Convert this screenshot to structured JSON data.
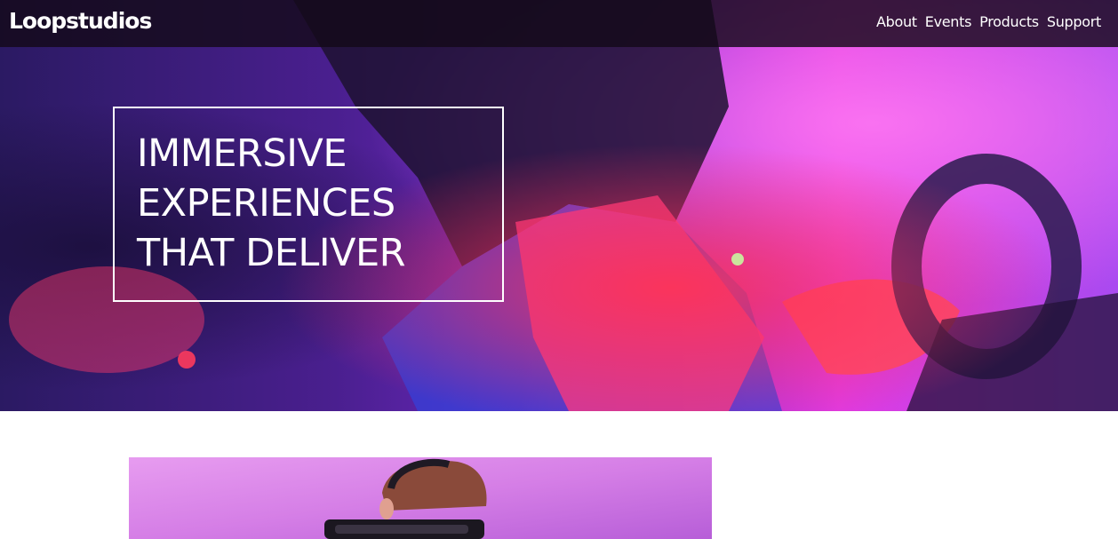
{
  "header": {
    "logo": "Loopstudios",
    "nav": [
      {
        "label": "About"
      },
      {
        "label": "Events"
      },
      {
        "label": "Products"
      },
      {
        "label": "Support"
      }
    ]
  },
  "hero": {
    "headline_lines": [
      "IMMERSIVE",
      "EXPERIENCES",
      "THAT DELIVER"
    ]
  },
  "colors": {
    "nav_background": "#140a19",
    "hero_magenta": "#e02bd6",
    "hero_blue": "#2a2fd0",
    "hero_red": "#ff2a55",
    "feature_purple": "#c86fe0",
    "text": "#ffffff"
  }
}
